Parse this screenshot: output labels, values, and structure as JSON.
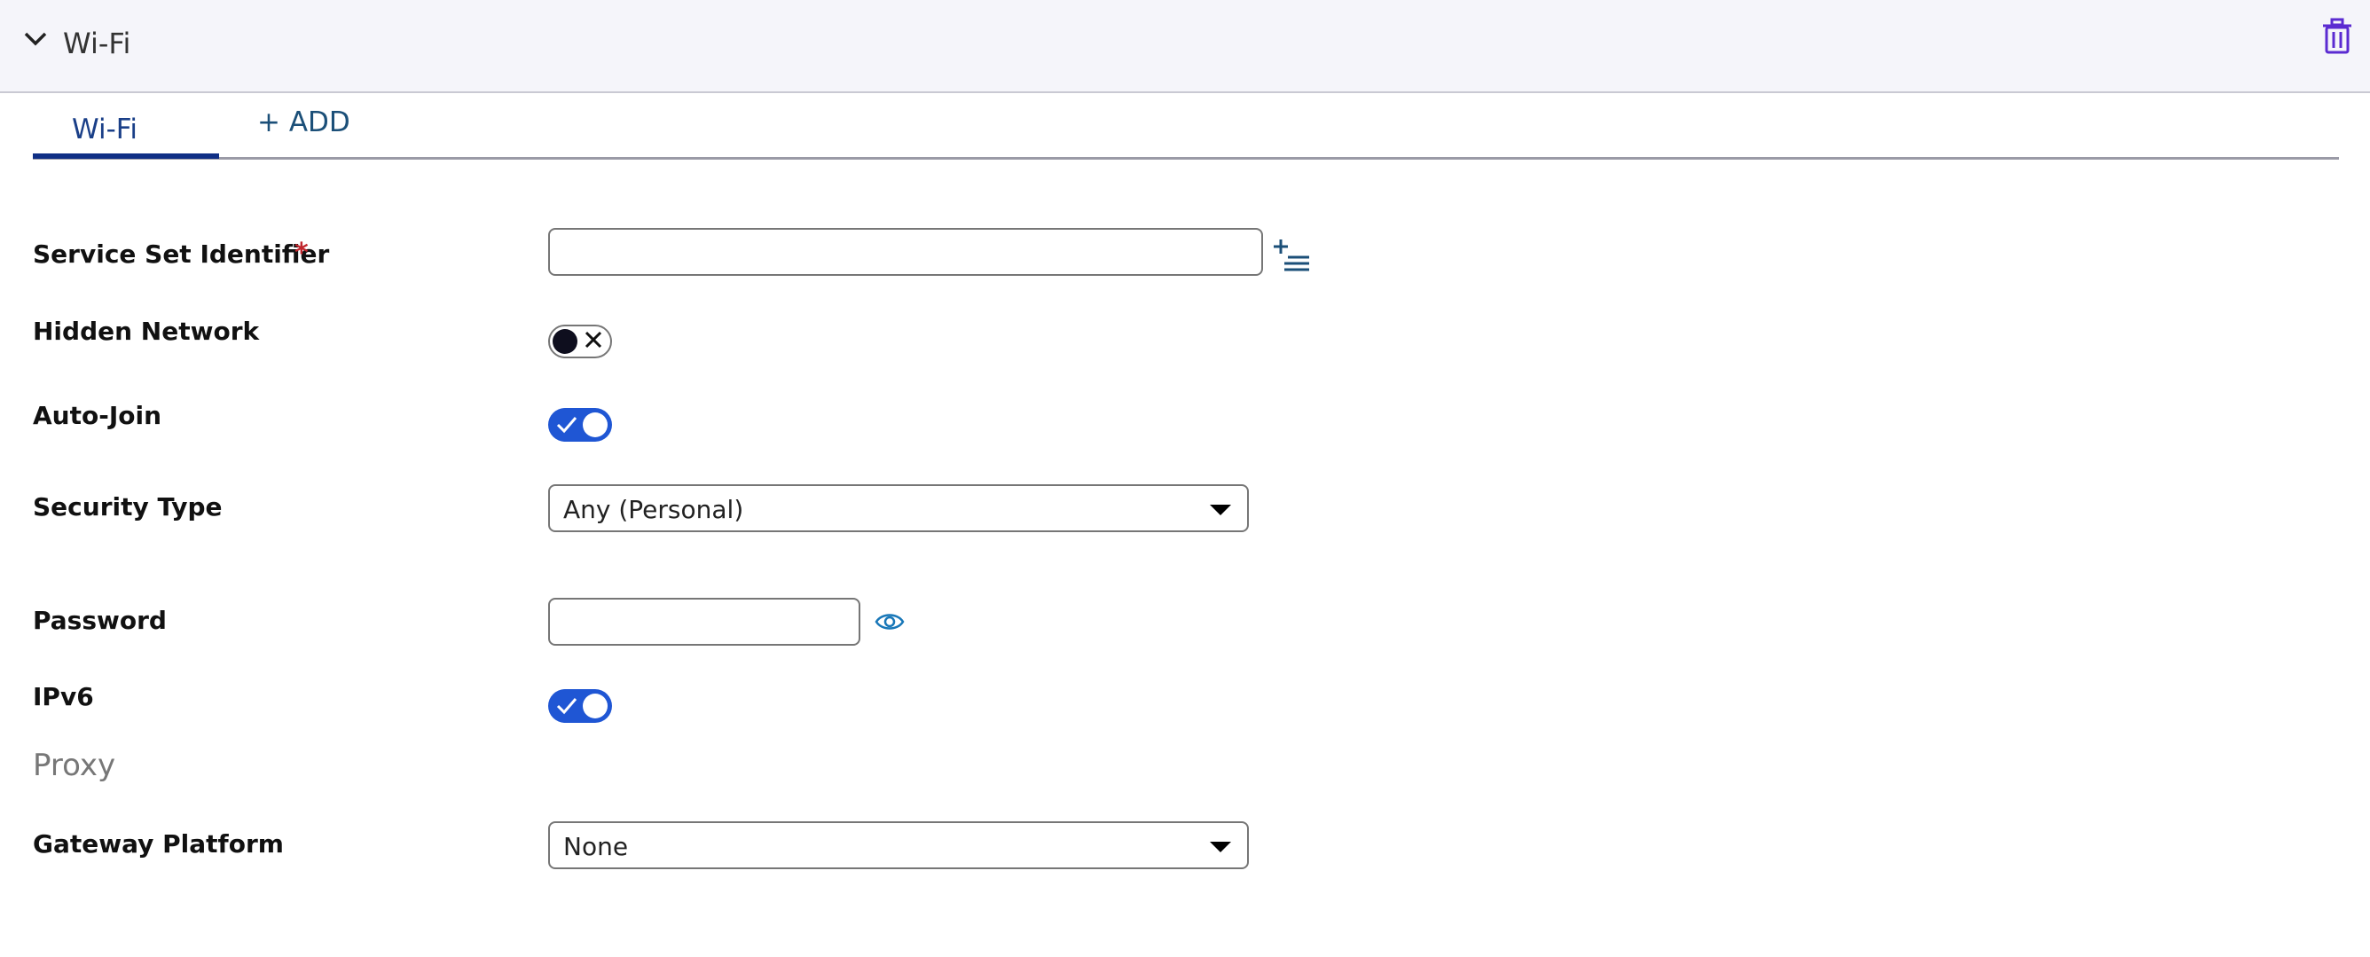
{
  "header": {
    "title": "Wi-Fi",
    "collapse_icon": "chevron-down-icon",
    "delete_icon": "trash-icon"
  },
  "tabs": {
    "active": "Wi-Fi",
    "add": "+ ADD"
  },
  "fields": {
    "ssid": {
      "label": "Service Set Identifier",
      "required_mark": "*",
      "value": "",
      "action_icon": "add-list-icon"
    },
    "hidden_network": {
      "label": "Hidden Network",
      "state": "off"
    },
    "auto_join": {
      "label": "Auto-Join",
      "state": "on"
    },
    "security_type": {
      "label": "Security Type",
      "value": "Any (Personal)"
    },
    "password": {
      "label": "Password",
      "value": "",
      "action_icon": "eye-icon"
    },
    "ipv6": {
      "label": "IPv6",
      "state": "on"
    },
    "proxy_section": "Proxy",
    "gateway_platform": {
      "label": "Gateway Platform",
      "value": "None"
    }
  },
  "colors": {
    "accent": "#1f56d4",
    "tab_active": "#1a3f88",
    "required": "#c0262d",
    "header_bg": "#f5f5fa"
  }
}
